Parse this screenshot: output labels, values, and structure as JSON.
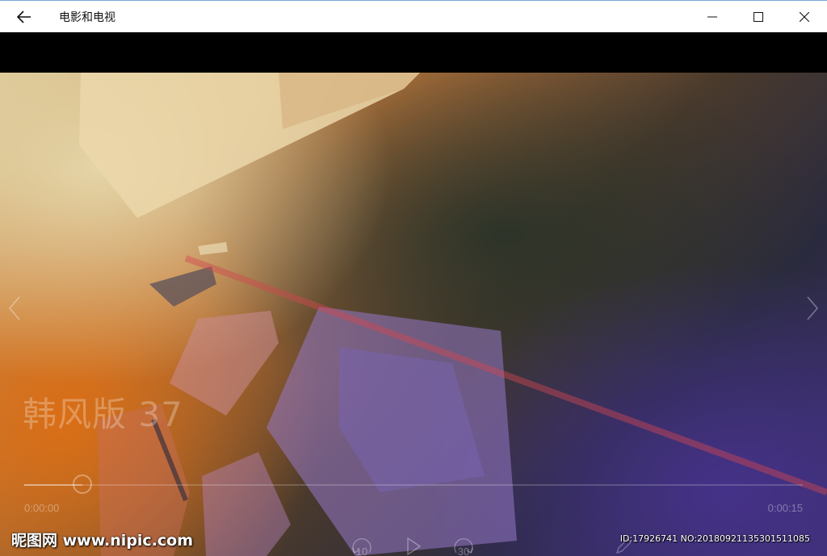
{
  "window": {
    "title": "电影和电视"
  },
  "titlebar": {
    "back_icon": "back-arrow-icon",
    "minimize_icon": "minimize-icon",
    "maximize_icon": "maximize-icon",
    "close_icon": "close-icon"
  },
  "video": {
    "title": "韩风版 37",
    "elapsed": "0:00:00",
    "duration": "0:00:15",
    "progress_fraction": 0.075
  },
  "controls": {
    "skip_back_label": "10",
    "skip_forward_label": "30"
  },
  "watermark": {
    "logo": "昵图网 www.nipic.com",
    "id_text": "ID:17926741 NO:20180921135301511085"
  },
  "colors": {
    "titlebar_bg": "#ffffff",
    "titlebar_border": "#7aa7d8",
    "letterbox": "#000000"
  }
}
